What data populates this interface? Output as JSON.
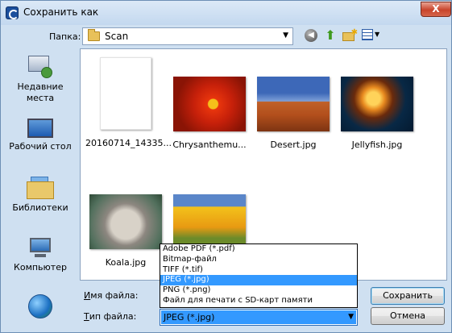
{
  "window": {
    "title": "Сохранить как"
  },
  "titlebar": {
    "close_glyph": "X"
  },
  "look_in": {
    "label": "Папка:",
    "value": "Scan"
  },
  "toolbar": {
    "back_icon": "back-arrow-icon",
    "up_icon": "up-folder-icon",
    "new_folder_icon": "new-folder-icon",
    "views_icon": "views-menu-icon"
  },
  "places": [
    {
      "label_line1": "Недавние",
      "label_line2": "места",
      "icon": "recent-places-icon"
    },
    {
      "label_line1": "Рабочий стол",
      "label_line2": "",
      "icon": "desktop-icon"
    },
    {
      "label_line1": "Библиотеки",
      "label_line2": "",
      "icon": "libraries-icon"
    },
    {
      "label_line1": "Компьютер",
      "label_line2": "",
      "icon": "computer-icon"
    },
    {
      "label_line1": "",
      "label_line2": "",
      "icon": "network-icon"
    }
  ],
  "files": [
    {
      "name": "20160714_14335..."
    },
    {
      "name": "Chrysanthemu..."
    },
    {
      "name": "Desert.jpg"
    },
    {
      "name": "Jellyfish.jpg"
    },
    {
      "name": "Koala.jpg"
    },
    {
      "name": ""
    }
  ],
  "filename": {
    "label_underlined": "И",
    "label_rest": "мя файла:",
    "value": ""
  },
  "filetype": {
    "label_underlined": "Т",
    "label_rest": "ип файла:",
    "value": "JPEG (*.jpg)",
    "options": [
      "Adobe PDF (*.pdf)",
      "Bitmap-файл",
      "TIFF (*.tif)",
      "JPEG (*.jpg)",
      "PNG (*.png)",
      "Файл для печати с SD-карт памяти"
    ],
    "highlighted_index": 3
  },
  "buttons": {
    "save": "Сохранить",
    "cancel": "Отмена"
  },
  "colors": {
    "selection": "#3399ff",
    "titlebar": "#c3d8ef",
    "close": "#c8442b"
  }
}
